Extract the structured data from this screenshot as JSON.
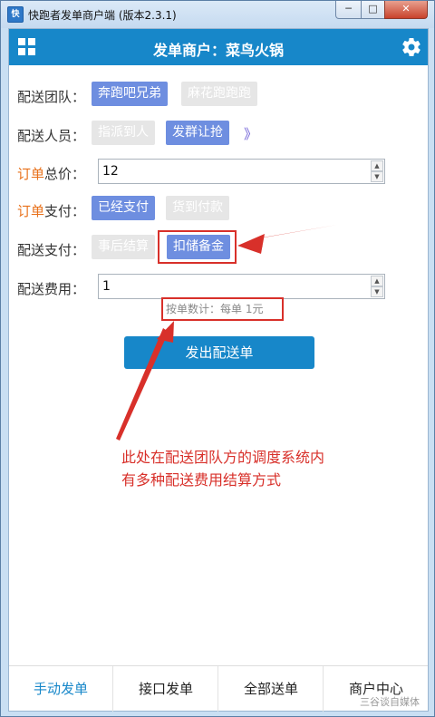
{
  "window": {
    "title": "快跑者发单商户端 (版本2.3.1)",
    "icon_text": "快",
    "minimize": "─",
    "maximize": "□",
    "close": "✕"
  },
  "header": {
    "title": "发单商户：菜鸟火锅",
    "left_icon": "grid-icon",
    "right_icon": "gear-icon"
  },
  "form": {
    "team": {
      "label": "配送团队：",
      "options": [
        "奔跑吧兄弟",
        "麻花跑跑跑"
      ],
      "selected": "奔跑吧兄弟"
    },
    "courier": {
      "label": "配送人员：",
      "options": [
        "指派到人",
        "发群让抢"
      ],
      "selected": "发群让抢",
      "more": "》"
    },
    "total": {
      "label_hl": "订单",
      "label": "总价：",
      "value": "12"
    },
    "payment": {
      "label_hl": "订单",
      "label": "支付：",
      "options": [
        "已经支付",
        "货到付款"
      ],
      "selected": "已经支付"
    },
    "delivery_payment": {
      "label": "配送支付：",
      "options": [
        "事后结算",
        "扣储备金"
      ],
      "selected": "扣储备金"
    },
    "fee": {
      "label": "配送费用：",
      "value": "1",
      "hint": "按单数计：每单 1元"
    },
    "submit": "发出配送单"
  },
  "annotation": {
    "line1": "此处在配送团队方的调度系统内",
    "line2": "有多种配送费用结算方式"
  },
  "tabs": [
    {
      "label": "手动发单",
      "active": true
    },
    {
      "label": "接口发单",
      "active": false
    },
    {
      "label": "全部送单",
      "active": false
    },
    {
      "label": "商户中心",
      "active": false
    }
  ],
  "watermark": "三谷谈自媒体",
  "colors": {
    "accent": "#1787c9",
    "chip_on": "#6e8ee0",
    "annotation": "#d8302a",
    "highlight": "#e8711b"
  }
}
